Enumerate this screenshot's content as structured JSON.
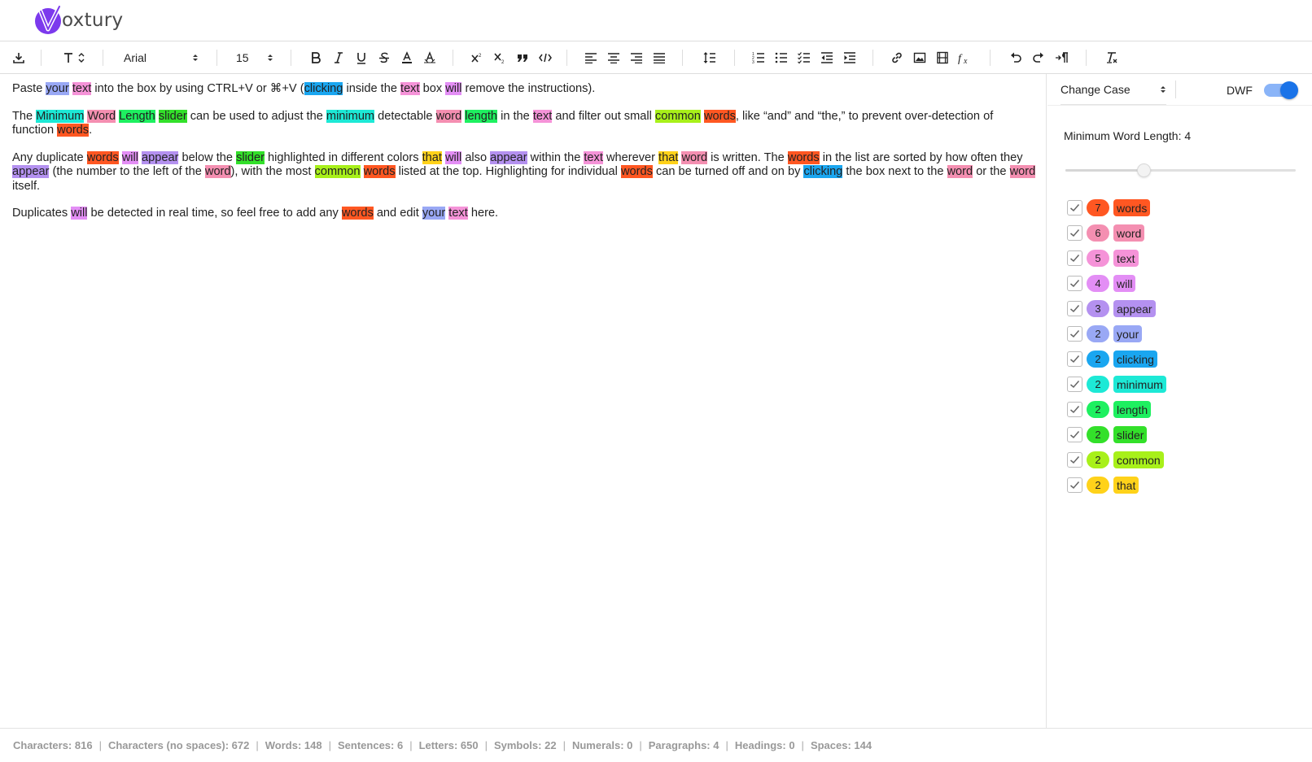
{
  "app": {
    "name": "oxtury",
    "logo_letter": "V"
  },
  "toolbar": {
    "font_family": "Arial",
    "font_size": "15",
    "icons": [
      "download-icon",
      "text-style-icon",
      "bold-icon",
      "italic-icon",
      "underline-icon",
      "strikethrough-icon",
      "font-color-icon",
      "highlight-icon",
      "superscript-icon",
      "subscript-icon",
      "blockquote-icon",
      "code-icon",
      "align-left-icon",
      "align-center-icon",
      "align-right-icon",
      "align-justify-icon",
      "line-spacing-icon",
      "ordered-list-icon",
      "bullet-list-icon",
      "checklist-icon",
      "outdent-icon",
      "indent-icon",
      "link-icon",
      "image-icon",
      "video-icon",
      "formula-icon",
      "undo-icon",
      "redo-icon",
      "text-direction-icon",
      "clear-format-icon"
    ]
  },
  "colors": {
    "words": "#ff5722",
    "word": "#f48fb1",
    "text": "#f593d8",
    "will": "#e38ef5",
    "appear": "#b491f0",
    "your": "#99a8f5",
    "clicking": "#1aa6f0",
    "minimum": "#1de9d6",
    "length": "#1ef060",
    "slider": "#33e02a",
    "common": "#a8f01a",
    "that": "#ffd21a"
  },
  "editor": {
    "p1": {
      "t1": "Paste ",
      "h1": "your",
      "t2": " ",
      "h2": "text",
      "t3": " into the box by using CTRL+V or ⌘+V (",
      "h3": "clicking",
      "t4": " inside the ",
      "h4": "text",
      "t5": " box ",
      "h5": "will",
      "t6": " remove the instructions)."
    },
    "p2": {
      "t1": "The ",
      "h1": "Minimum",
      "t2": " ",
      "h2": "Word",
      "t3": " ",
      "h3": "Length",
      "t4": " ",
      "h4": "slider",
      "t5": " can be used to adjust the ",
      "h5": "minimum",
      "t6": " detectable ",
      "h6": "word",
      "t7": " ",
      "h7": "length",
      "t8": " in the ",
      "h8": "text",
      "t9": " and filter out small ",
      "h9": "common",
      "t10": " ",
      "h10": "words",
      "t11": ", like “and” and “the,” to prevent over-detection of function ",
      "h11": "words",
      "t12": "."
    },
    "p3": {
      "t1": "Any duplicate ",
      "h1": "words",
      "t2": " ",
      "h2": "will",
      "t3": " ",
      "h3": "appear",
      "t4": " below the ",
      "h4": "slider",
      "t5": " highlighted in different colors ",
      "h5": "that",
      "t6": " ",
      "h6": "will",
      "t7": " also ",
      "h7": "appear",
      "t8": " within the ",
      "h8": "text",
      "t9": " wherever ",
      "h9": "that",
      "t10": " ",
      "h10": "word",
      "t11": " is written. The ",
      "h11": "words",
      "t12": " in the list are sorted by how often they ",
      "h12": "appear",
      "t13": " (the number to the left of the ",
      "h13": "word",
      "t14": "), with the most ",
      "h14": "common",
      "t15": " ",
      "h15": "words",
      "t16": " listed at the top. Highlighting for individual ",
      "h16": "words",
      "t17": " can be turned off and on by ",
      "h17": "clicking",
      "t18": " the box next to the ",
      "h18": "word",
      "t19": " or the ",
      "h19": "word",
      "t20": " itself."
    },
    "p4": {
      "t1": "Duplicates ",
      "h1": "will",
      "t2": " be detected in real time, so feel free to add any ",
      "h2": "words",
      "t3": " and edit ",
      "h3": "your",
      "t4": " ",
      "h4": "text",
      "t5": " here."
    }
  },
  "side": {
    "change_case": "Change Case",
    "dwf_label": "DWF",
    "dwf_on": true,
    "min_word_length_label": "Minimum Word Length: 4",
    "slider_fraction": 0.34,
    "words": [
      {
        "count": "7",
        "word": "words",
        "checked": true
      },
      {
        "count": "6",
        "word": "word",
        "checked": true
      },
      {
        "count": "5",
        "word": "text",
        "checked": true
      },
      {
        "count": "4",
        "word": "will",
        "checked": true
      },
      {
        "count": "3",
        "word": "appear",
        "checked": true
      },
      {
        "count": "2",
        "word": "your",
        "checked": true
      },
      {
        "count": "2",
        "word": "clicking",
        "checked": true
      },
      {
        "count": "2",
        "word": "minimum",
        "checked": true
      },
      {
        "count": "2",
        "word": "length",
        "checked": true
      },
      {
        "count": "2",
        "word": "slider",
        "checked": true
      },
      {
        "count": "2",
        "word": "common",
        "checked": true
      },
      {
        "count": "2",
        "word": "that",
        "checked": true
      }
    ]
  },
  "status": [
    "Characters: 816",
    "Characters (no spaces): 672",
    "Words: 148",
    "Sentences: 6",
    "Letters: 650",
    "Symbols: 22",
    "Numerals: 0",
    "Paragraphs: 4",
    "Headings: 0",
    "Spaces: 144"
  ]
}
